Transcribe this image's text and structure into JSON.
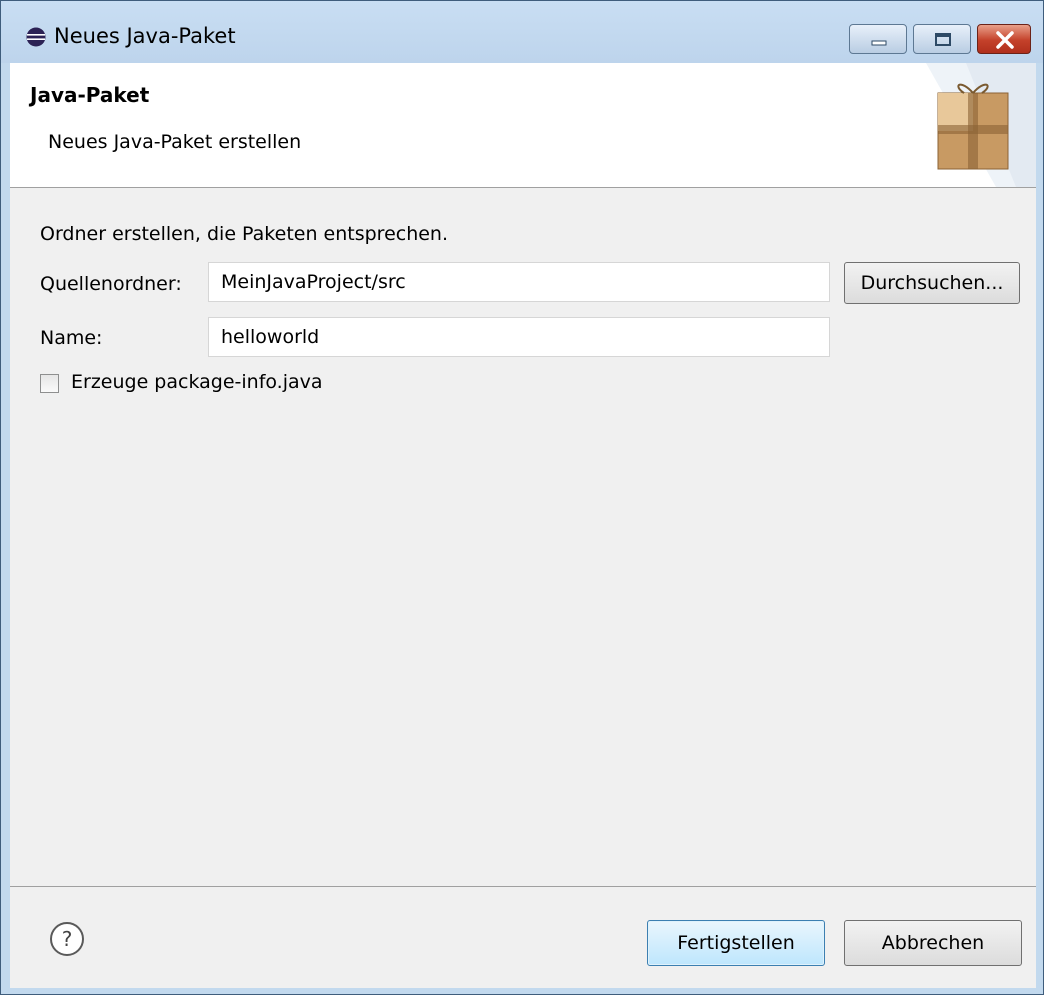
{
  "window": {
    "title": "Neues Java-Paket",
    "icon": "eclipse-icon",
    "controls": {
      "minimize": "minimize-icon",
      "maximize": "maximize-icon",
      "close": "close-icon"
    }
  },
  "header": {
    "title": "Java-Paket",
    "subtitle": "Neues Java-Paket erstellen",
    "graphic": "package-icon"
  },
  "form": {
    "info": "Ordner erstellen, die Paketen entsprechen.",
    "source_folder": {
      "label": "Quellenordner:",
      "value": "MeinJavaProject/src"
    },
    "browse_button": "Durchsuchen...",
    "name": {
      "label": "Name:",
      "value": "helloworld"
    },
    "package_info_checkbox": {
      "label": "Erzeuge package-info.java",
      "checked": false
    }
  },
  "footer": {
    "help_icon": "help-icon",
    "finish_button": "Fertigstellen",
    "cancel_button": "Abbrechen"
  },
  "colors": {
    "titlebar": "#c2d9ee",
    "close_button": "#c4412a",
    "content_bg": "#f0f0f0",
    "header_bg": "#ffffff"
  }
}
